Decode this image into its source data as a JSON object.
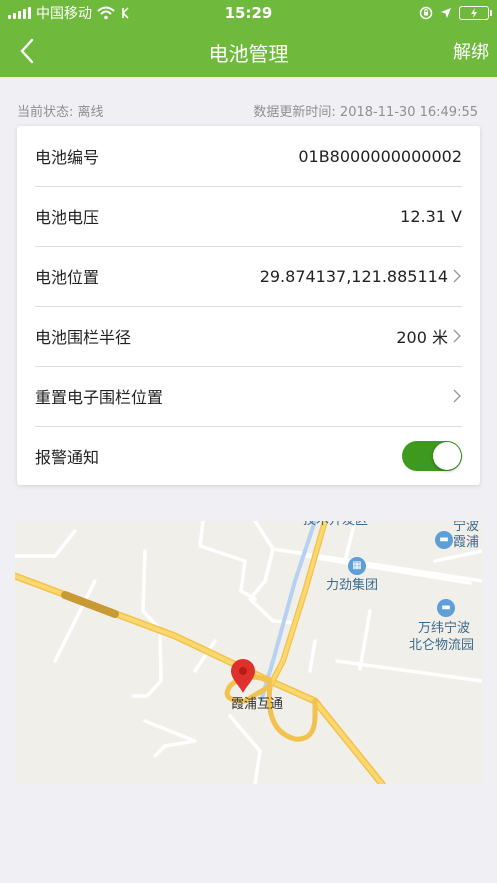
{
  "status_bar": {
    "carrier": "中国移动",
    "time": "15:29"
  },
  "nav": {
    "title": "电池管理",
    "right_action": "解绑"
  },
  "status_line": {
    "state_text": "当前状态: 离线",
    "update_text": "数据更新时间: 2018-11-30 16:49:55"
  },
  "settings": {
    "battery_id": {
      "label": "电池编号",
      "value": "01B8000000000002"
    },
    "voltage": {
      "label": "电池电压",
      "value": "12.31 V"
    },
    "location": {
      "label": "电池位置",
      "value": "29.874137,121.885114"
    },
    "fence_radius": {
      "label": "电池围栏半径",
      "value": "200 米"
    },
    "reset_fence": {
      "label": "重置电子围栏位置"
    },
    "alarm": {
      "label": "报警通知",
      "enabled": true
    }
  },
  "map": {
    "labels": {
      "top_cut": "技术开发区",
      "li_jin": "力劲集团",
      "wan_wei_1": "万纬宁波",
      "wan_wei_2": "北仑物流园",
      "ningbo_1": "宁波",
      "ningbo_2": "霞浦",
      "xiapu": "霞浦互通"
    }
  },
  "colors": {
    "primary_green": "#6fba3d",
    "toggle_green": "#3d9a1f",
    "marker_red": "#e0302c"
  }
}
